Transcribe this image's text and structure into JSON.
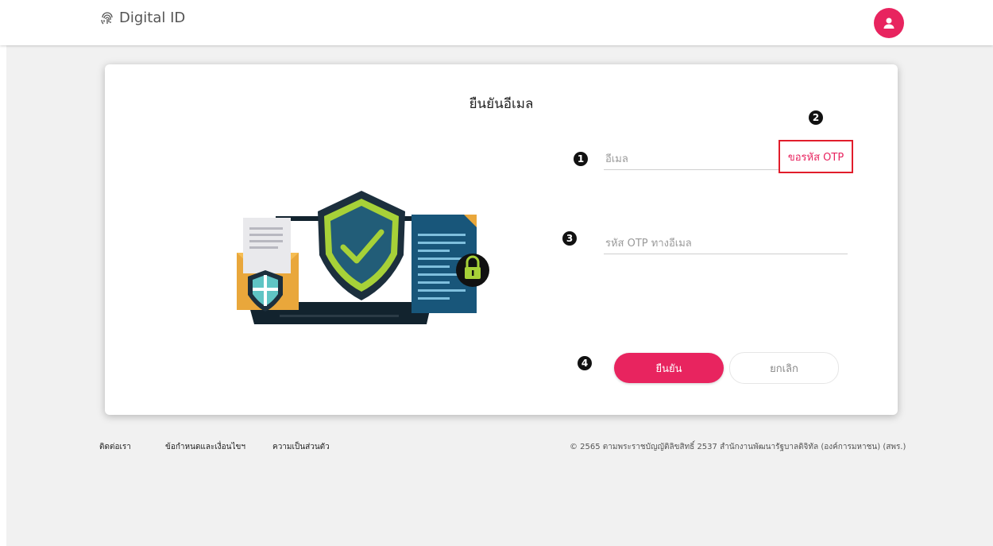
{
  "header": {
    "brand_name": "Digital ID",
    "brand_icon": "fingerprint-icon",
    "avatar_icon": "user-icon",
    "accent_color": "#e8245f"
  },
  "card": {
    "title": "ยืนยันอีเมล",
    "markers": [
      "1",
      "2",
      "3",
      "4"
    ],
    "email_placeholder": "อีเมล",
    "request_otp_label": "ขอรหัส OTP",
    "otp_placeholder": "รหัส OTP ทางอีเมล",
    "confirm_label": "ยืนยัน",
    "cancel_label": "ยกเลิก"
  },
  "footer": {
    "links": [
      "ติดต่อเรา",
      "ข้อกำหนดและเงื่อนไขฯ",
      "ความเป็นส่วนตัว"
    ],
    "copyright": "© 2565 ตามพระราชบัญญัติลิขสิทธิ์ 2537 สำนักงานพัฒนารัฐบาลดิจิทัล (องค์การมหาชน) (สพร.)"
  }
}
